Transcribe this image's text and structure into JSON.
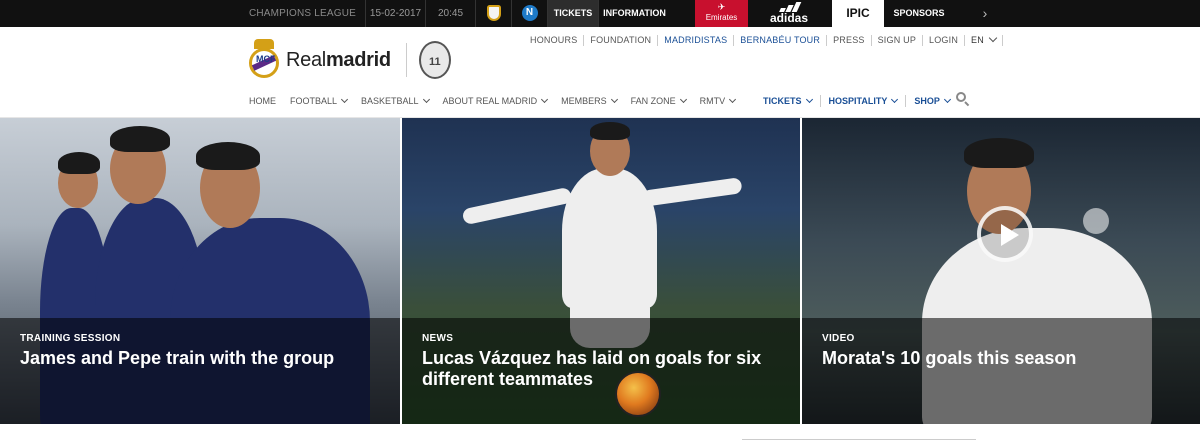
{
  "match_bar": {
    "competition": "CHAMPIONS LEAGUE",
    "date": "15-02-2017",
    "time": "20:45",
    "away_initial": "N",
    "tickets": "TICKETS",
    "information": "INFORMATION",
    "sponsor_emirates": "Emirates",
    "sponsor_adidas": "adidas",
    "sponsor_ipic": "IPIC",
    "sponsors": "SPONSORS",
    "next_arrow": "›"
  },
  "header": {
    "logo_light": "Real",
    "logo_bold": "madrid",
    "badge_text": "11",
    "utility_links": [
      "HONOURS",
      "FOUNDATION",
      "MADRIDISTAS",
      "BERNABÉU TOUR",
      "PRESS",
      "SIGN UP",
      "LOGIN"
    ],
    "language": "EN",
    "main_nav": [
      "HOME",
      "FOOTBALL",
      "BASKETBALL",
      "ABOUT REAL MADRID",
      "MEMBERS",
      "FAN ZONE",
      "RMTV"
    ],
    "right_nav": [
      "TICKETS",
      "HOSPITALITY",
      "SHOP"
    ]
  },
  "colors": {
    "link_blue": "#1a4f96",
    "emirates_red": "#c8102e",
    "gold": "#d4a017"
  },
  "hero": [
    {
      "kicker": "TRAINING SESSION",
      "headline": "James and Pepe train with the group"
    },
    {
      "kicker": "NEWS",
      "headline": "Lucas Vázquez has laid on goals for six different teammates"
    },
    {
      "kicker": "VIDEO",
      "headline": "Morata's 10 goals this season"
    }
  ]
}
